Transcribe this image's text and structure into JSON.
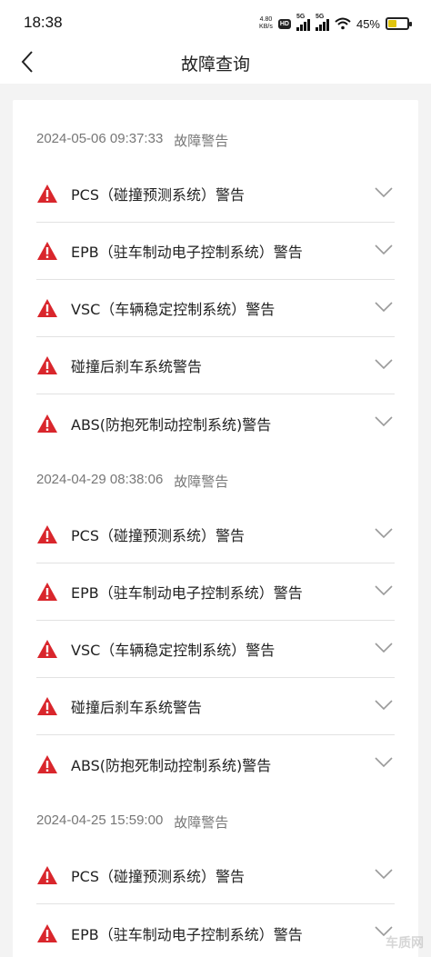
{
  "status_bar": {
    "time": "18:38",
    "net_speed_value": "4.80",
    "net_speed_unit": "KB/s",
    "hd_badge": "HD",
    "sim1_label": "5G",
    "sim2_label": "5G",
    "battery_percent": "45%",
    "battery_level": 0.45,
    "battery_color": "#e1c50e"
  },
  "header": {
    "title": "故障查询",
    "back_icon": "chevron-left-icon"
  },
  "sections": [
    {
      "timestamp": "2024-05-06 09:37:33",
      "type": "故障警告",
      "faults": [
        "PCS（碰撞预测系统）警告",
        "EPB（驻车制动电子控制系统）警告",
        "VSC（车辆稳定控制系统）警告",
        "碰撞后刹车系统警告",
        "ABS(防抱死制动控制系统)警告"
      ]
    },
    {
      "timestamp": "2024-04-29 08:38:06",
      "type": "故障警告",
      "faults": [
        "PCS（碰撞预测系统）警告",
        "EPB（驻车制动电子控制系统）警告",
        "VSC（车辆稳定控制系统）警告",
        "碰撞后刹车系统警告",
        "ABS(防抱死制动控制系统)警告"
      ]
    },
    {
      "timestamp": "2024-04-25 15:59:00",
      "type": "故障警告",
      "faults": [
        "PCS（碰撞预测系统）警告",
        "EPB（驻车制动电子控制系统）警告"
      ]
    }
  ],
  "icons": {
    "warning": "warning-triangle-icon",
    "expand": "chevron-down-icon"
  },
  "colors": {
    "warning_red": "#d9262c",
    "chevron_gray": "#9a9a9a"
  },
  "watermark": "车质网"
}
